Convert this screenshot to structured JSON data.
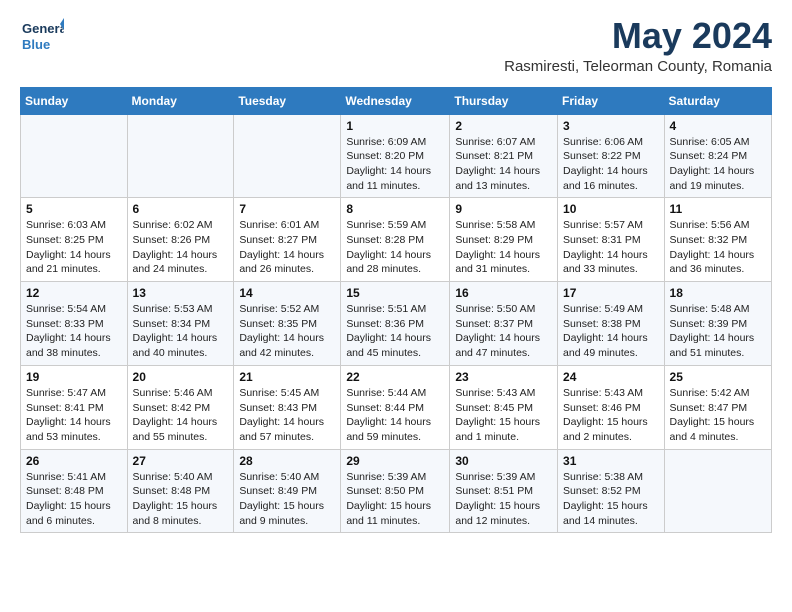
{
  "logo": {
    "line1": "General",
    "line2": "Blue"
  },
  "title": "May 2024",
  "location": "Rasmiresti, Teleorman County, Romania",
  "days_of_week": [
    "Sunday",
    "Monday",
    "Tuesday",
    "Wednesday",
    "Thursday",
    "Friday",
    "Saturday"
  ],
  "weeks": [
    [
      {
        "num": "",
        "info": ""
      },
      {
        "num": "",
        "info": ""
      },
      {
        "num": "",
        "info": ""
      },
      {
        "num": "1",
        "info": "Sunrise: 6:09 AM\nSunset: 8:20 PM\nDaylight: 14 hours and 11 minutes."
      },
      {
        "num": "2",
        "info": "Sunrise: 6:07 AM\nSunset: 8:21 PM\nDaylight: 14 hours and 13 minutes."
      },
      {
        "num": "3",
        "info": "Sunrise: 6:06 AM\nSunset: 8:22 PM\nDaylight: 14 hours and 16 minutes."
      },
      {
        "num": "4",
        "info": "Sunrise: 6:05 AM\nSunset: 8:24 PM\nDaylight: 14 hours and 19 minutes."
      }
    ],
    [
      {
        "num": "5",
        "info": "Sunrise: 6:03 AM\nSunset: 8:25 PM\nDaylight: 14 hours and 21 minutes."
      },
      {
        "num": "6",
        "info": "Sunrise: 6:02 AM\nSunset: 8:26 PM\nDaylight: 14 hours and 24 minutes."
      },
      {
        "num": "7",
        "info": "Sunrise: 6:01 AM\nSunset: 8:27 PM\nDaylight: 14 hours and 26 minutes."
      },
      {
        "num": "8",
        "info": "Sunrise: 5:59 AM\nSunset: 8:28 PM\nDaylight: 14 hours and 28 minutes."
      },
      {
        "num": "9",
        "info": "Sunrise: 5:58 AM\nSunset: 8:29 PM\nDaylight: 14 hours and 31 minutes."
      },
      {
        "num": "10",
        "info": "Sunrise: 5:57 AM\nSunset: 8:31 PM\nDaylight: 14 hours and 33 minutes."
      },
      {
        "num": "11",
        "info": "Sunrise: 5:56 AM\nSunset: 8:32 PM\nDaylight: 14 hours and 36 minutes."
      }
    ],
    [
      {
        "num": "12",
        "info": "Sunrise: 5:54 AM\nSunset: 8:33 PM\nDaylight: 14 hours and 38 minutes."
      },
      {
        "num": "13",
        "info": "Sunrise: 5:53 AM\nSunset: 8:34 PM\nDaylight: 14 hours and 40 minutes."
      },
      {
        "num": "14",
        "info": "Sunrise: 5:52 AM\nSunset: 8:35 PM\nDaylight: 14 hours and 42 minutes."
      },
      {
        "num": "15",
        "info": "Sunrise: 5:51 AM\nSunset: 8:36 PM\nDaylight: 14 hours and 45 minutes."
      },
      {
        "num": "16",
        "info": "Sunrise: 5:50 AM\nSunset: 8:37 PM\nDaylight: 14 hours and 47 minutes."
      },
      {
        "num": "17",
        "info": "Sunrise: 5:49 AM\nSunset: 8:38 PM\nDaylight: 14 hours and 49 minutes."
      },
      {
        "num": "18",
        "info": "Sunrise: 5:48 AM\nSunset: 8:39 PM\nDaylight: 14 hours and 51 minutes."
      }
    ],
    [
      {
        "num": "19",
        "info": "Sunrise: 5:47 AM\nSunset: 8:41 PM\nDaylight: 14 hours and 53 minutes."
      },
      {
        "num": "20",
        "info": "Sunrise: 5:46 AM\nSunset: 8:42 PM\nDaylight: 14 hours and 55 minutes."
      },
      {
        "num": "21",
        "info": "Sunrise: 5:45 AM\nSunset: 8:43 PM\nDaylight: 14 hours and 57 minutes."
      },
      {
        "num": "22",
        "info": "Sunrise: 5:44 AM\nSunset: 8:44 PM\nDaylight: 14 hours and 59 minutes."
      },
      {
        "num": "23",
        "info": "Sunrise: 5:43 AM\nSunset: 8:45 PM\nDaylight: 15 hours and 1 minute."
      },
      {
        "num": "24",
        "info": "Sunrise: 5:43 AM\nSunset: 8:46 PM\nDaylight: 15 hours and 2 minutes."
      },
      {
        "num": "25",
        "info": "Sunrise: 5:42 AM\nSunset: 8:47 PM\nDaylight: 15 hours and 4 minutes."
      }
    ],
    [
      {
        "num": "26",
        "info": "Sunrise: 5:41 AM\nSunset: 8:48 PM\nDaylight: 15 hours and 6 minutes."
      },
      {
        "num": "27",
        "info": "Sunrise: 5:40 AM\nSunset: 8:48 PM\nDaylight: 15 hours and 8 minutes."
      },
      {
        "num": "28",
        "info": "Sunrise: 5:40 AM\nSunset: 8:49 PM\nDaylight: 15 hours and 9 minutes."
      },
      {
        "num": "29",
        "info": "Sunrise: 5:39 AM\nSunset: 8:50 PM\nDaylight: 15 hours and 11 minutes."
      },
      {
        "num": "30",
        "info": "Sunrise: 5:39 AM\nSunset: 8:51 PM\nDaylight: 15 hours and 12 minutes."
      },
      {
        "num": "31",
        "info": "Sunrise: 5:38 AM\nSunset: 8:52 PM\nDaylight: 15 hours and 14 minutes."
      },
      {
        "num": "",
        "info": ""
      }
    ]
  ]
}
